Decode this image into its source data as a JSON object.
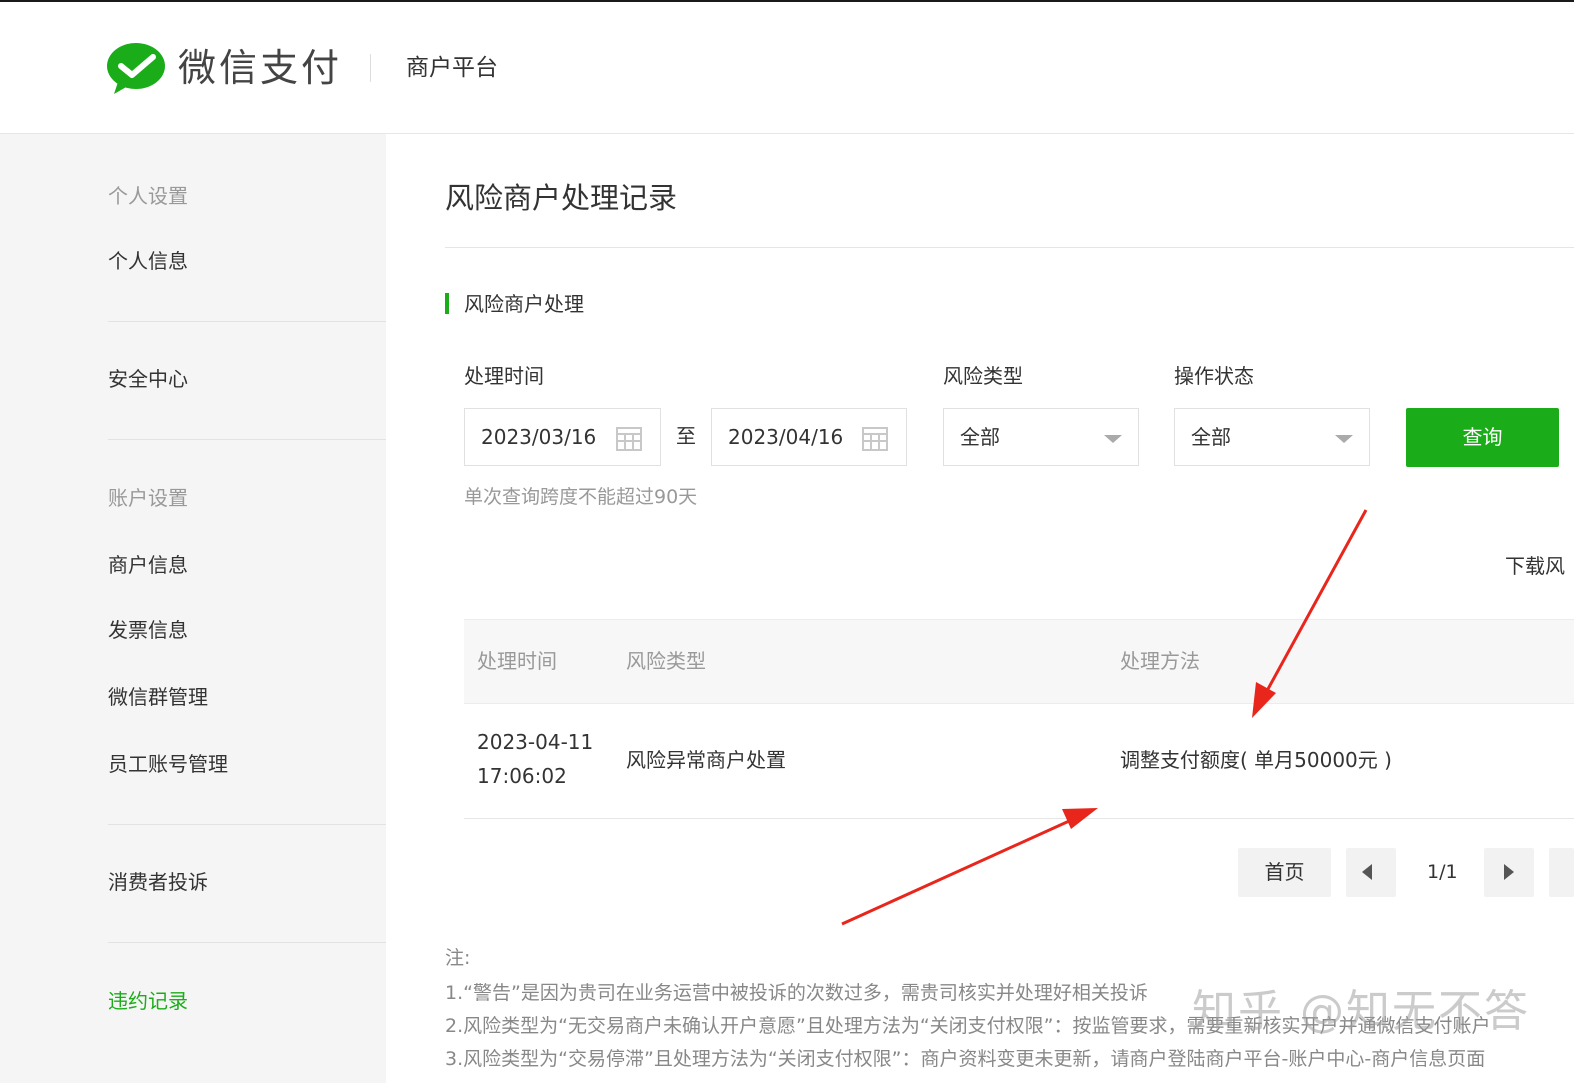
{
  "header": {
    "brand": "微信支付",
    "platform": "商户平台"
  },
  "sidebar": {
    "personal_group": "个人设置",
    "personal_info": "个人信息",
    "security_center": "安全中心",
    "account_group": "账户设置",
    "merchant_info": "商户信息",
    "invoice_info": "发票信息",
    "wechat_group_mgmt": "微信群管理",
    "staff_account_mgmt": "员工账号管理",
    "consumer_complaints": "消费者投诉",
    "violation_records": "违约记录"
  },
  "main": {
    "page_title": "风险商户处理记录",
    "section_title": "风险商户处理"
  },
  "filters": {
    "time_label": "处理时间",
    "start_date": "2023/03/16",
    "to_text": "至",
    "end_date": "2023/04/16",
    "risk_type_label": "风险类型",
    "risk_type_value": "全部",
    "status_label": "操作状态",
    "status_value": "全部",
    "query_button": "查询",
    "hint": "单次查询跨度不能超过90天"
  },
  "download_link": "下载风",
  "table": {
    "headers": [
      "处理时间",
      "风险类型",
      "处理方法"
    ],
    "rows": [
      {
        "time": "2023-04-11 17:06:02",
        "risk_type": "风险异常商户处置",
        "method": "调整支付额度( 单月50000元 )"
      }
    ]
  },
  "pagination": {
    "first": "首页",
    "page_info": "1/1"
  },
  "notes": {
    "title": "注:",
    "line1": "1.“警告”是因为贵司在业务运营中被投诉的次数过多，需贵司核实并处理好相关投诉",
    "line2": "2.风险类型为“无交易商户未确认开户意愿”且处理方法为“关闭支付权限”：按监管要求，需要重新核实开户并通微信支付账户",
    "line3": "3.风险类型为“交易停滞”且处理方法为“关闭支付权限”：商户资料变更未更新，请商户登陆商户平台-账户中心-商户信息页面"
  },
  "watermark": "知乎 @知无不答",
  "colors": {
    "brand_green": "#1aad19",
    "arrow_red": "#e8261c"
  }
}
